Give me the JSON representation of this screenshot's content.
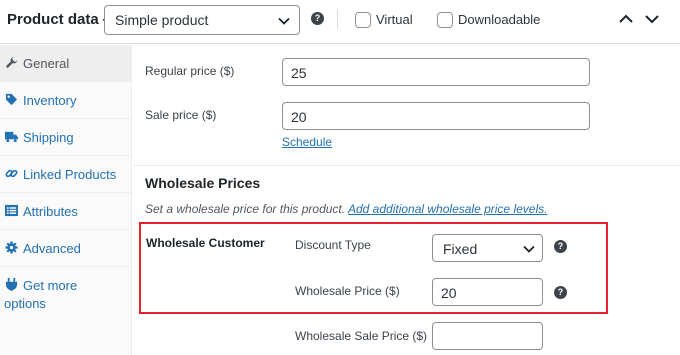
{
  "header": {
    "title": "Product data —",
    "product_type": "Simple product",
    "virtual_label": "Virtual",
    "downloadable_label": "Downloadable",
    "help_glyph": "?"
  },
  "sidebar": {
    "tabs": [
      {
        "label": "General",
        "icon": "wrench-icon",
        "active": true
      },
      {
        "label": "Inventory",
        "icon": "tag-icon",
        "active": false
      },
      {
        "label": "Shipping",
        "icon": "truck-icon",
        "active": false
      },
      {
        "label": "Linked Products",
        "icon": "link-icon",
        "active": false
      },
      {
        "label": "Attributes",
        "icon": "list-icon",
        "active": false
      },
      {
        "label": "Advanced",
        "icon": "gear-icon",
        "active": false
      },
      {
        "label": "Get more",
        "label2": "options",
        "icon": "plugin-icon",
        "active": false
      }
    ]
  },
  "pricing": {
    "regular_price_label": "Regular price ($)",
    "regular_price_value": "25",
    "sale_price_label": "Sale price ($)",
    "sale_price_value": "20",
    "schedule_link": "Schedule"
  },
  "wholesale": {
    "section_title": "Wholesale Prices",
    "description": "Set a wholesale price for this product.",
    "add_levels_link": "Add additional wholesale price levels.",
    "role_label": "Wholesale Customer",
    "discount_type_label": "Discount Type",
    "discount_type_value": "Fixed",
    "wholesale_price_label": "Wholesale Price ($)",
    "wholesale_price_value": "20",
    "wholesale_sale_price_label": "Wholesale Sale Price ($)",
    "wholesale_sale_price_value": ""
  },
  "colors": {
    "link": "#2271b1",
    "highlight_border": "#e3222b",
    "active_tab_bg": "#eeeeee"
  }
}
